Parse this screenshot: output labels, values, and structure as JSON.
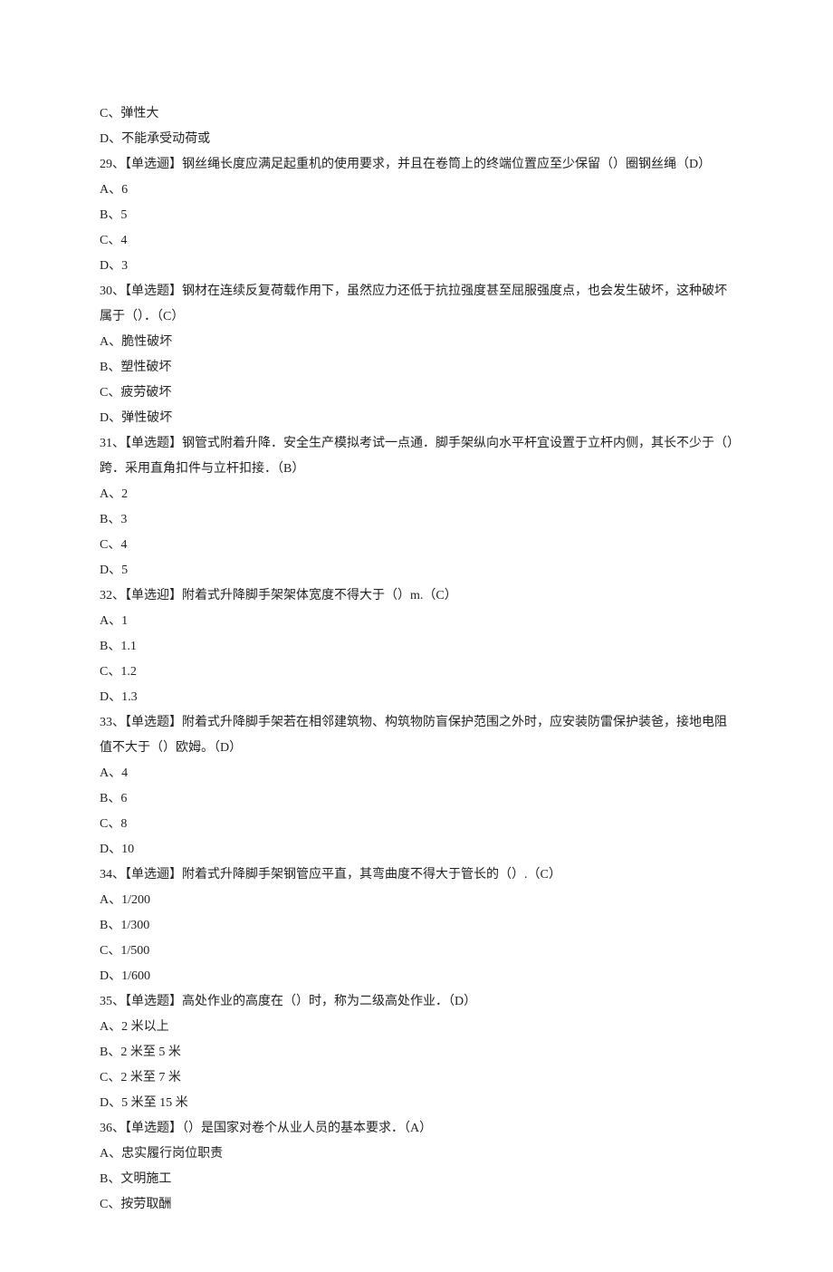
{
  "pre_options": [
    "C、弹性大",
    "D、不能承受动荷或"
  ],
  "questions": [
    {
      "text": "29、【单选逦】钢丝绳长度应满足起重机的使用要求，并且在卷筒上的终端位置应至少保留（）圈钢丝绳（D）",
      "opts": [
        "A、6",
        "B、5",
        "C、4",
        "D、3"
      ]
    },
    {
      "text": "30、【单选题】钢材在连续反复荷载作用下，虽然应力还低于抗拉强度甚至屈服强度点，也会发生破坏，这种破坏属于（）．（C）",
      "opts": [
        "A、脆性破坏",
        "B、塑性破坏",
        "C、疲劳破坏",
        "D、弹性破坏"
      ]
    },
    {
      "text": "31、【单选题】钢管式附着升降．安全生产模拟考试一点通．脚手架纵向水平杆宜设置于立杆内侧，其长不少于（）跨．采用直角扣件与立杆扣接．（B）",
      "opts": [
        "A、2",
        "B、3",
        "C、4",
        "D、5"
      ]
    },
    {
      "text": "32、【单选迎】附着式升降脚手架架体宽度不得大于（）m.（C）",
      "opts": [
        "A、1",
        "B、1.1",
        "C、1.2",
        "D、1.3"
      ]
    },
    {
      "text": "33、【单选题】附着式升降脚手架若在相邻建筑物、构筑物防盲保护范围之外时，应安装防雷保护装爸，接地电阻值不大于（）欧姆。（D）",
      "opts": [
        "A、4",
        "B、6",
        "C、8",
        "D、10"
      ]
    },
    {
      "text": "34、【单选逦】附着式升降脚手架钢管应平直，其弯曲度不得大于管长的（）.（C）",
      "opts": [
        "A、1/200",
        "B、1/300",
        "C、1/500",
        "D、1/600"
      ]
    },
    {
      "text": "35、【单选题】高处作业的高度在（）时，称为二级高处作业．（D）",
      "opts": [
        "A、2 米以上",
        "B、2 米至 5 米",
        "C、2 米至 7 米",
        "D、5 米至 15 米"
      ]
    },
    {
      "text": "36、【单选题】（）是国家对卷个从业人员的基本要求．（A）",
      "opts": [
        "A、忠实履行岗位职责",
        "B、文明施工",
        "C、按劳取酬"
      ]
    }
  ]
}
